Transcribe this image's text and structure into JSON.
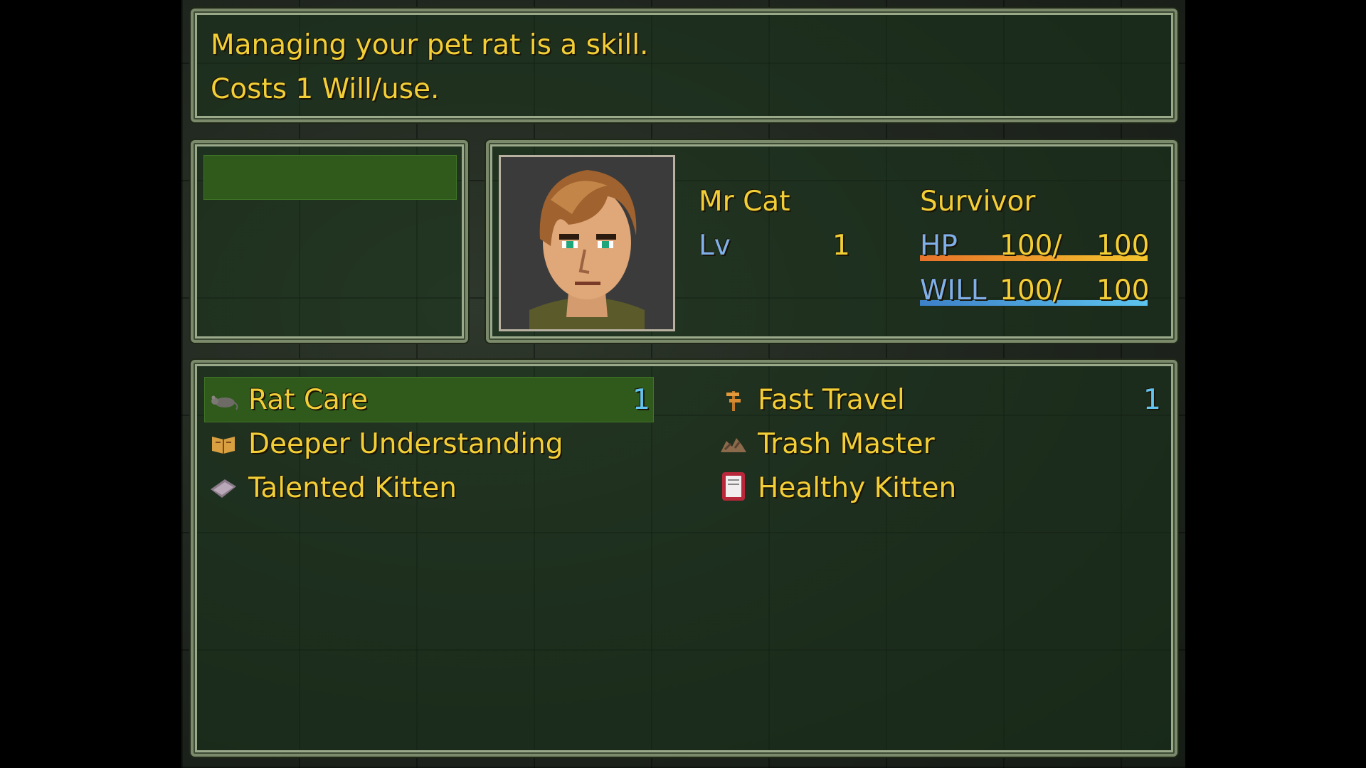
{
  "help": {
    "line1": "Managing your pet rat is a skill.",
    "line2": "Costs 1 Will/use."
  },
  "actor": {
    "name": "Mr Cat",
    "class": "Survivor",
    "level_label": "Lv",
    "level": "1",
    "hp_label": "HP",
    "hp_value": "100/",
    "hp_max": "100",
    "will_label": "WILL",
    "will_value": "100/",
    "will_max": "100",
    "hp_ratio": 1.0,
    "will_ratio": 1.0
  },
  "skills": [
    {
      "name": "Rat Care",
      "cost": "1",
      "icon": "rat-icon",
      "selected": true
    },
    {
      "name": "Fast Travel",
      "cost": "1",
      "icon": "signpost-icon",
      "selected": false
    },
    {
      "name": "Deeper Understanding",
      "cost": "",
      "icon": "open-book-icon",
      "selected": false
    },
    {
      "name": "Trash Master",
      "cost": "",
      "icon": "trash-pile-icon",
      "selected": false
    },
    {
      "name": "Talented Kitten",
      "cost": "",
      "icon": "book-icon",
      "selected": false
    },
    {
      "name": "Healthy Kitten",
      "cost": "",
      "icon": "paper-card-icon",
      "selected": false
    }
  ],
  "colors": {
    "text": "#f2cf37",
    "system_blue": "#7fb0ea",
    "hp_gauge_start": "#e8722a",
    "hp_gauge_end": "#f3c52c",
    "will_gauge_start": "#3d80c8",
    "will_gauge_end": "#5cc4ee",
    "highlight": "#2f5a1c"
  }
}
